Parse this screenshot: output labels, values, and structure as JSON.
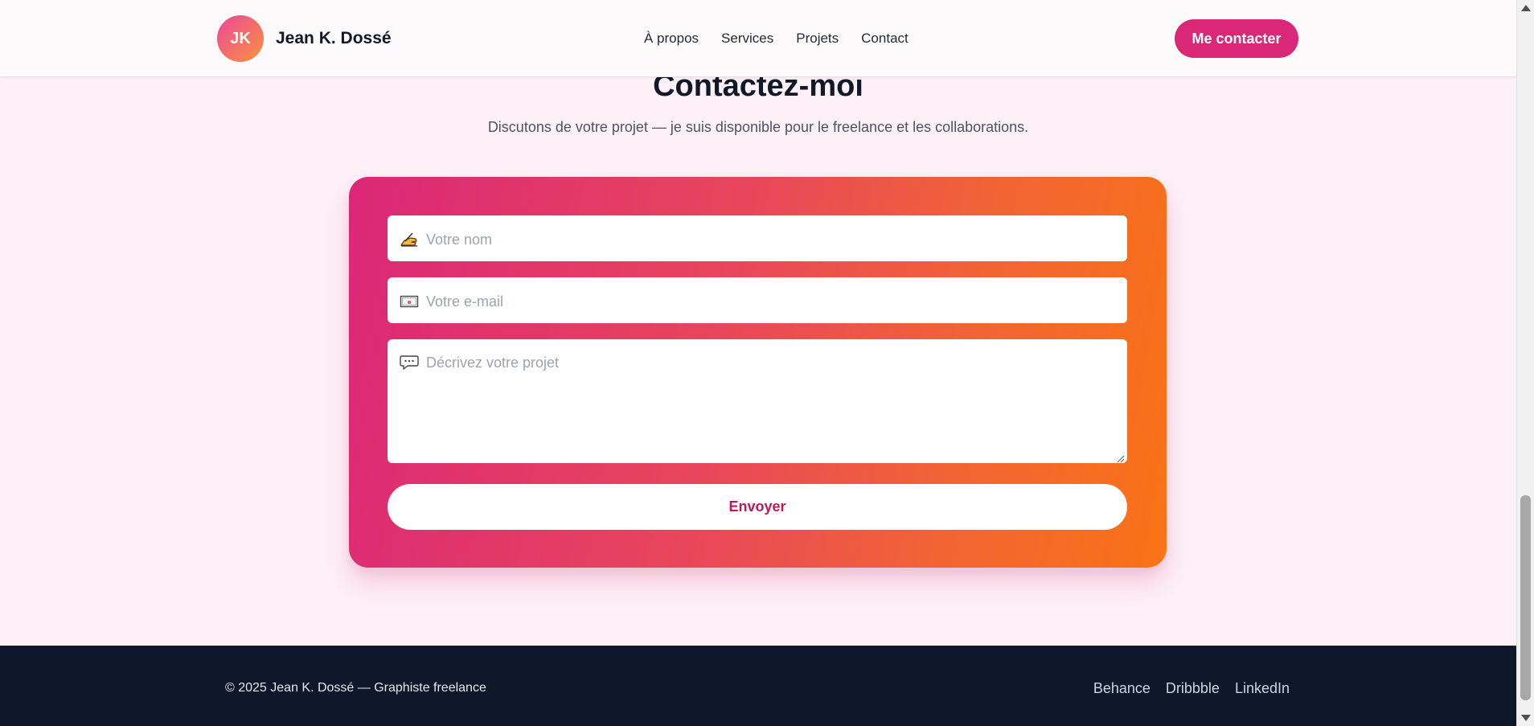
{
  "header": {
    "avatar_initials": "JK",
    "brand_name": "Jean K. Dossé",
    "nav": [
      "À propos",
      "Services",
      "Projets",
      "Contact"
    ],
    "cta_label": "Me contacter"
  },
  "contact": {
    "title": "Contactez-moi",
    "subtitle": "Discutons de votre projet — je suis disponible pour le freelance et les collaborations.",
    "name_placeholder": "Votre nom",
    "email_placeholder": "Votre e-mail",
    "message_placeholder": "Décrivez votre projet",
    "submit_label": "Envoyer"
  },
  "footer": {
    "copyright": "© 2025 Jean K. Dossé — Graphiste freelance",
    "links": [
      "Behance",
      "Dribbble",
      "LinkedIn"
    ]
  },
  "colors": {
    "accent": "#db2777",
    "gradient_end": "#f97316",
    "footer_bg": "#0f172a",
    "page_bg": "#fdf0f6"
  },
  "icons": {
    "name_field": "writing-hand-icon",
    "email_field": "envelope-icon",
    "message_field": "speech-bubble-icon"
  }
}
